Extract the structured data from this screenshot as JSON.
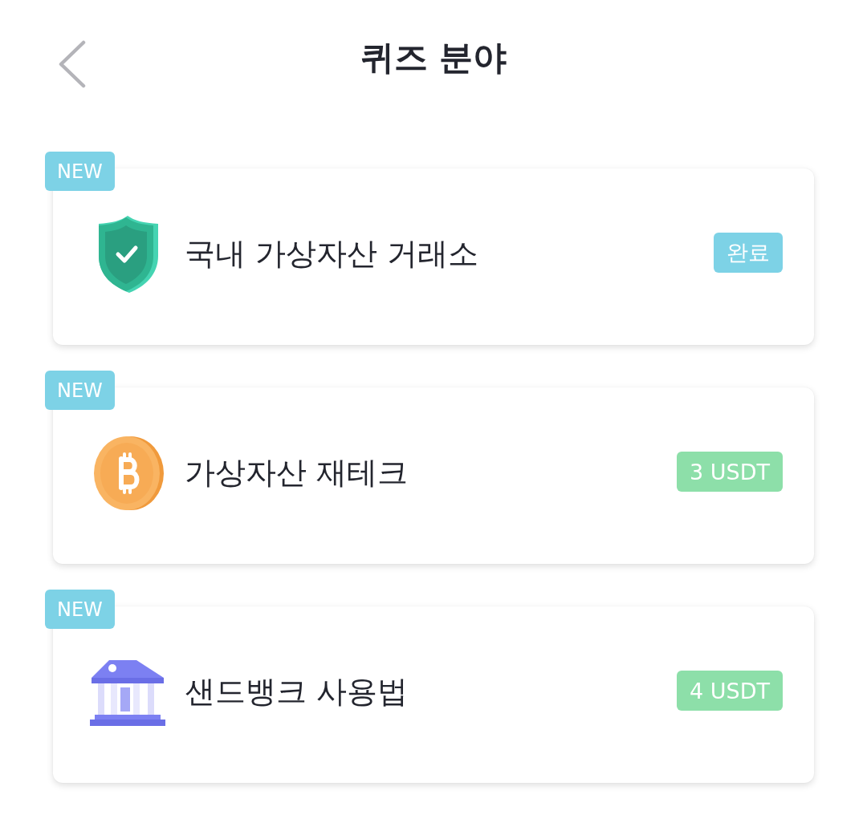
{
  "header": {
    "title": "퀴즈 분야"
  },
  "categories": [
    {
      "tag": "NEW",
      "title": "국내 가상자산 거래소",
      "status": {
        "kind": "completed",
        "text": "완료"
      }
    },
    {
      "tag": "NEW",
      "title": "가상자산 재테크",
      "status": {
        "kind": "reward",
        "text": "3 USDT"
      }
    },
    {
      "tag": "NEW",
      "title": "샌드뱅크 사용법",
      "status": {
        "kind": "reward",
        "text": "4 USDT"
      }
    }
  ]
}
